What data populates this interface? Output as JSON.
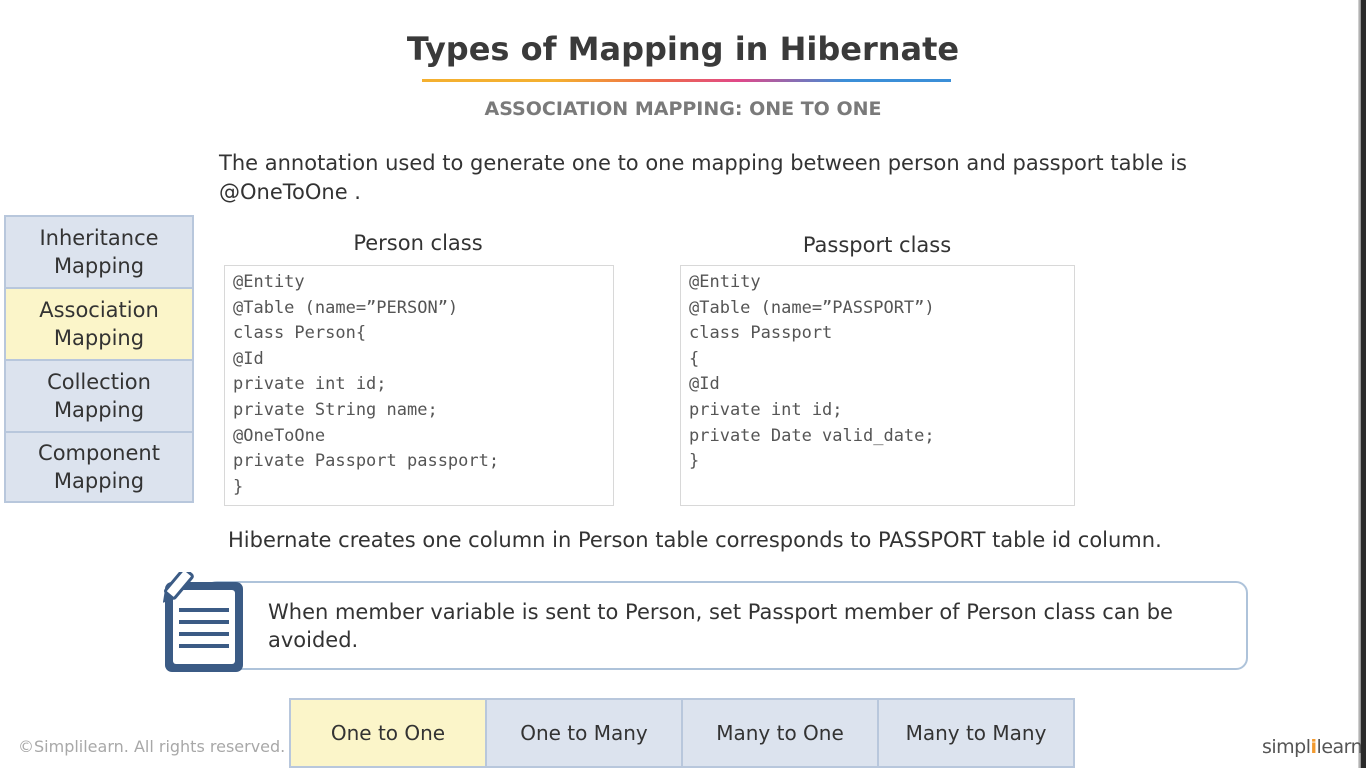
{
  "slide": {
    "title": "Types of Mapping in Hibernate",
    "subtitle": "ASSOCIATION MAPPING: ONE TO ONE",
    "intro": "The annotation used to generate one to one mapping between person and passport table is @OneToOne ."
  },
  "side_nav": {
    "items": [
      {
        "label": "Inheritance\nMapping",
        "active": false
      },
      {
        "label": "Association\nMapping",
        "active": true
      },
      {
        "label": "Collection\nMapping",
        "active": false
      },
      {
        "label": "Component\nMapping",
        "active": false
      }
    ]
  },
  "person": {
    "label": "Person class",
    "code": [
      "@Entity",
      "@Table (name=”PERSON”)",
      "class Person{",
      "@Id",
      "private int id;",
      "private String name;",
      "@OneToOne",
      "private Passport passport;",
      "}"
    ]
  },
  "passport": {
    "label": "Passport class",
    "code": [
      "@Entity",
      "@Table (name=”PASSPORT”)",
      "class Passport",
      "{",
      "@Id",
      "private int id;",
      "private Date valid_date;",
      "}"
    ]
  },
  "main_note": "Hibernate creates one column in Person table corresponds to PASSPORT table id column.",
  "callout": {
    "text": "When member variable is sent to Person, set Passport member of Person class can be avoided.",
    "icon": "notepad-pencil-icon"
  },
  "bottom_tabs": [
    {
      "label": "One to One",
      "active": true
    },
    {
      "label": "One to Many",
      "active": false
    },
    {
      "label": "Many to One",
      "active": false
    },
    {
      "label": "Many to Many",
      "active": false
    }
  ],
  "footer": {
    "copyright": "©Simplilearn. All rights reserved.",
    "logo_left": "simpl",
    "logo_pipe": "i",
    "logo_right": "learn"
  },
  "colors": {
    "nav_bg": "#dce3ee",
    "nav_active": "#fbf5c9",
    "nav_border": "#b8c7dc",
    "icon_blue": "#3b5b85",
    "logo_accent": "#f29a2e"
  }
}
